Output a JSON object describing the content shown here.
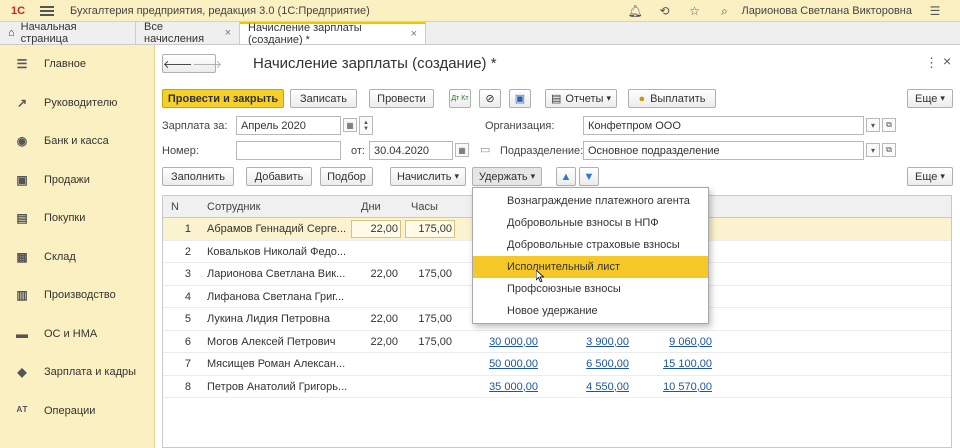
{
  "titlebar": {
    "title": "Бухгалтерия предприятия, редакция 3.0   (1С:Предприятие)",
    "user": "Ларионова Светлана Викторовна",
    "logo": "1С"
  },
  "tabs": [
    {
      "label": "Начальная страница"
    },
    {
      "label": "Все начисления"
    },
    {
      "label": "Начисление зарплаты (создание) *"
    }
  ],
  "nav": [
    {
      "label": "Главное",
      "icon": "☰"
    },
    {
      "label": "Руководителю",
      "icon": "↗"
    },
    {
      "label": "Банк и касса",
      "icon": "◉"
    },
    {
      "label": "Продажи",
      "icon": "▣"
    },
    {
      "label": "Покупки",
      "icon": "▤"
    },
    {
      "label": "Склад",
      "icon": "▦"
    },
    {
      "label": "Производство",
      "icon": "▥"
    },
    {
      "label": "ОС и НМА",
      "icon": "▬"
    },
    {
      "label": "Зарплата и кадры",
      "icon": "◆"
    },
    {
      "label": "Операции",
      "icon": "ᴬᵀ"
    }
  ],
  "form": {
    "title": "Начисление зарплаты (создание) *",
    "toolbar": {
      "post_close": "Провести и закрыть",
      "save": "Записать",
      "post": "Провести",
      "dt_kt": "Дт Кт",
      "reports": "Отчеты",
      "pay": "Выплатить",
      "more": "Еще"
    },
    "salary_for_label": "Зарплата за:",
    "salary_for_value": "Апрель 2020",
    "number_label": "Номер:",
    "number_value": "",
    "from_label": "от:",
    "date_value": "30.04.2020",
    "org_label": "Организация:",
    "org_value": "Конфетпром ООО",
    "dept_label": "Подразделение:",
    "dept_value": "Основное подразделение",
    "actions": {
      "fill": "Заполнить",
      "add": "Добавить",
      "pick": "Подбор",
      "accrue": "Начислить",
      "deduct": "Удержать",
      "more": "Еще"
    },
    "table": {
      "headers": {
        "n": "N",
        "employee": "Сотрудник",
        "days": "Дни",
        "hours": "Часы"
      },
      "rows": [
        {
          "n": "1",
          "name": "Абрамов Геннадий Серге...",
          "days": "22,00",
          "hours": "175,00",
          "a": "",
          "b": "",
          "c": ""
        },
        {
          "n": "2",
          "name": "Ковальков Николай Федо...",
          "days": "",
          "hours": "",
          "a": "",
          "b": "",
          "c": ""
        },
        {
          "n": "3",
          "name": "Ларионова Светлана Вик...",
          "days": "22,00",
          "hours": "175,00",
          "a": "",
          "b": "",
          "c": ""
        },
        {
          "n": "4",
          "name": "Лифанова Светлана Григ...",
          "days": "",
          "hours": "",
          "a": "",
          "b": "",
          "c": ""
        },
        {
          "n": "5",
          "name": "Лукина Лидия Петровна",
          "days": "22,00",
          "hours": "175,00",
          "a": "",
          "b": "",
          "c": ""
        },
        {
          "n": "6",
          "name": "Могов Алексей Петрович",
          "days": "22,00",
          "hours": "175,00",
          "a": "30 000,00",
          "b": "3 900,00",
          "c": "9 060,00"
        },
        {
          "n": "7",
          "name": "Мясищев Роман Алексан...",
          "days": "",
          "hours": "",
          "a": "50 000,00",
          "b": "6 500,00",
          "c": "15 100,00"
        },
        {
          "n": "8",
          "name": "Петров Анатолий Григорь...",
          "days": "",
          "hours": "",
          "a": "35 000,00",
          "b": "4 550,00",
          "c": "10 570,00"
        }
      ]
    }
  },
  "dropdown": {
    "items": [
      "Вознаграждение платежного агента",
      "Добровольные взносы в НПФ",
      "Добровольные страховые взносы",
      "Исполнительный лист",
      "Профсоюзные взносы",
      "Новое удержание"
    ],
    "highlighted_index": 3
  },
  "colors": {
    "accent": "#f5cf2a",
    "sidebar": "#fbf0c2",
    "link": "#1a56a8",
    "highlight": "#f6c827"
  }
}
